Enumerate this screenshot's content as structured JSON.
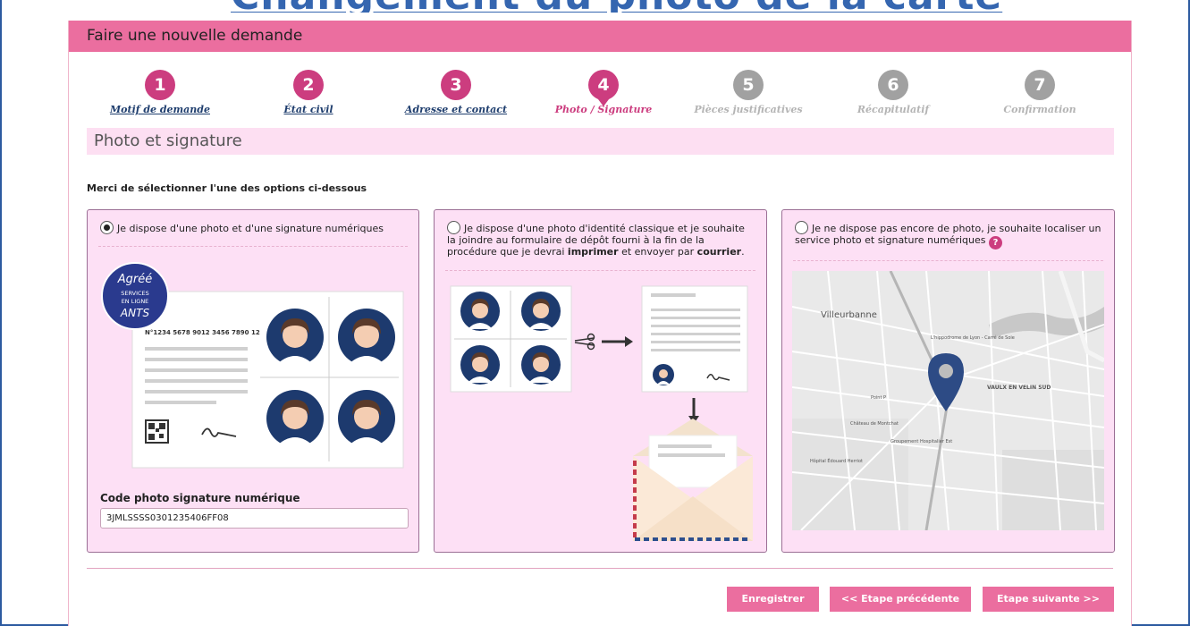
{
  "top_title": "Changement du photo de la carte",
  "header": {
    "title": "Faire une nouvelle demande"
  },
  "steps": [
    {
      "num": "1",
      "label": "Motif de demande",
      "state": "done"
    },
    {
      "num": "2",
      "label": "État civil",
      "state": "done"
    },
    {
      "num": "3",
      "label": "Adresse et contact",
      "state": "done"
    },
    {
      "num": "4",
      "label": "Photo / Signature",
      "state": "current"
    },
    {
      "num": "5",
      "label": "Pièces justificatives",
      "state": "todo"
    },
    {
      "num": "6",
      "label": "Récapitulatif",
      "state": "todo"
    },
    {
      "num": "7",
      "label": "Confirmation",
      "state": "todo"
    }
  ],
  "section": {
    "title": "Photo et signature",
    "prompt": "Merci de sélectionner l'une des options ci-dessous"
  },
  "options": {
    "digital": {
      "label": "Je dispose d'une photo et d'une signature numériques",
      "selected": true
    },
    "classic": {
      "label_part1": "Je dispose d'une photo d'identité classique et je souhaite la joindre au formulaire de dépôt fourni à la fin de la procédure que je devrai ",
      "bold1": "imprimer",
      "label_part2": " et envoyer par ",
      "bold2": "courrier",
      "label_end": ".",
      "selected": false
    },
    "locate": {
      "label": "Je ne dispose pas encore de photo, je souhaite localiser un service photo et signature numériques",
      "help": "?",
      "selected": false
    }
  },
  "badge": {
    "line1": "Agréé",
    "line2": "SERVICES",
    "line3": "EN LIGNE",
    "line4": "ANTS"
  },
  "card_sample_number": "N°1234 5678 9012 3456 7890 12",
  "code_field": {
    "label": "Code photo signature numérique",
    "value": "3JMLSSSS0301235406FF08"
  },
  "map_labels": {
    "city1": "Villeurbanne",
    "city2": "VAULX EN VELIN SUD",
    "place1": "L'hippodrome de Lyon - Carré de Soie",
    "place2": "Château de Montchat",
    "place3": "Groupement Hospitalier Est",
    "place4": "Hôpital Édouard Herriot",
    "place5": "Point P"
  },
  "buttons": {
    "save": "Enregistrer",
    "prev": "<< Etape précédente",
    "next": "Etape suivante >>"
  },
  "colors": {
    "primary": "#eb6e9f",
    "step_active": "#cc3d7f",
    "step_inactive": "#a1a1a1",
    "card_bg": "#fde0f5",
    "link": "#1f3e6e",
    "frame": "#2c5aa0"
  }
}
